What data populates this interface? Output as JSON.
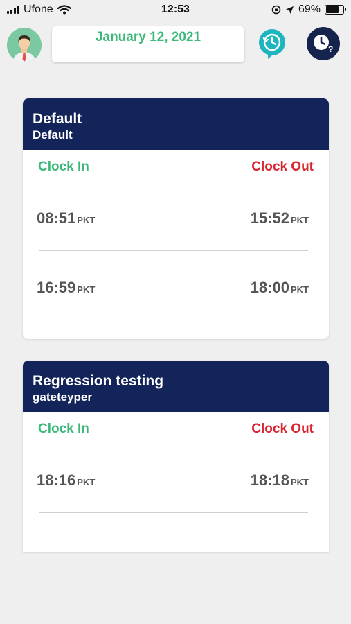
{
  "status_bar": {
    "carrier": "Ufone",
    "time": "12:53",
    "battery": "69%",
    "battery_level": 0.69
  },
  "header": {
    "date": "January 12, 2021"
  },
  "icons": {
    "avatar": "user-avatar",
    "history": "clock-history-icon",
    "help": "clock-question-icon",
    "wifi": "wifi-icon",
    "location": "location-arrow-icon"
  },
  "colors": {
    "accent_green": "#3cb87a",
    "clock_out_red": "#d9252f",
    "card_header": "#12245a",
    "teal": "#1fb5bf"
  },
  "cards": [
    {
      "title": "Default",
      "subtitle": "Default",
      "clock_in_label": "Clock In",
      "clock_out_label": "Clock Out",
      "entries": [
        {
          "in": "08:51",
          "in_tz": "PKT",
          "out": "15:52",
          "out_tz": "PKT"
        },
        {
          "in": "16:59",
          "in_tz": "PKT",
          "out": "18:00",
          "out_tz": "PKT"
        }
      ]
    },
    {
      "title": "Regression testing",
      "subtitle": "gateteyper",
      "clock_in_label": "Clock In",
      "clock_out_label": "Clock Out",
      "entries": [
        {
          "in": "18:16",
          "in_tz": "PKT",
          "out": "18:18",
          "out_tz": "PKT"
        }
      ]
    }
  ]
}
